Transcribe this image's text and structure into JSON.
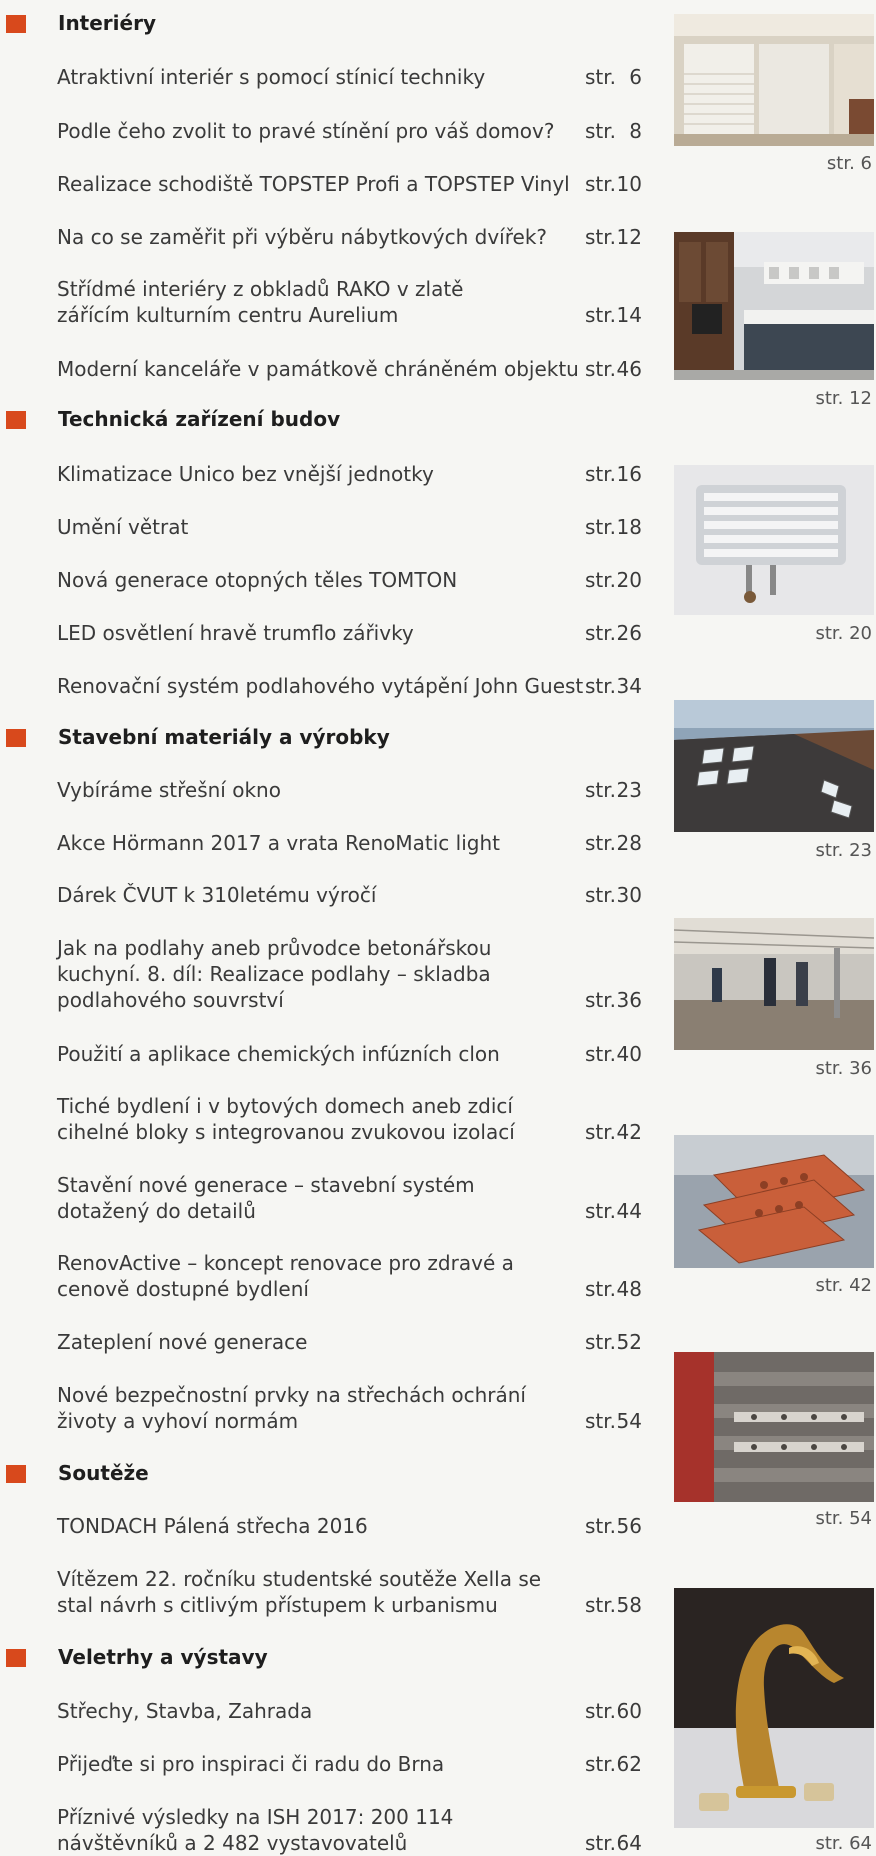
{
  "str_label": "str.",
  "sections": [
    {
      "title": "Interiéry",
      "items": [
        {
          "title": "Atraktivní interiér s pomocí stínicí techniky",
          "page": "6"
        },
        {
          "title": "Podle čeho zvolit to pravé stínění pro váš domov?",
          "page": "8"
        },
        {
          "title": "Realizace schodiště TOPSTEP Profi a TOPSTEP Vinyl",
          "page": "10"
        },
        {
          "title": "Na co se zaměřit při výběru nábytkových dvířek?",
          "page": "12"
        },
        {
          "title": "Střídmé interiéry z obkladů RAKO v zlatě zářícím kulturním centru Aurelium",
          "page": "14"
        },
        {
          "title": "Moderní kanceláře v památkově chráněném objektu",
          "page": "46"
        }
      ]
    },
    {
      "title": "Technická zařízení budov",
      "items": [
        {
          "title": "Klimatizace Unico bez vnější jednotky",
          "page": "16"
        },
        {
          "title": "Umění větrat",
          "page": "18"
        },
        {
          "title": "Nová generace otopných těles TOMTON",
          "page": "20"
        },
        {
          "title": "LED osvětlení hravě trumflo zářivky",
          "page": "26"
        },
        {
          "title": "Renovační systém podlahového vytápění John Guest",
          "page": "34"
        }
      ]
    },
    {
      "title": "Stavební materiály a výrobky",
      "items": [
        {
          "title": "Vybíráme střešní okno",
          "page": "23"
        },
        {
          "title": "Akce Hörmann 2017 a vrata RenoMatic light",
          "page": "28"
        },
        {
          "title": "Dárek ČVUT k 310letému výročí",
          "page": "30"
        },
        {
          "title": "Jak na podlahy aneb průvodce betonářskou kuchyní. 8. díl: Realizace podlahy – skladba podlahového souvrství",
          "page": "36"
        },
        {
          "title": "Použití a aplikace chemických infúzních clon",
          "page": "40"
        },
        {
          "title": "Tiché bydlení i v bytových domech aneb zdicí cihelné bloky s integrovanou zvukovou izolací",
          "page": "42"
        },
        {
          "title": "Stavění nové generace – stavební systém dotažený do detailů",
          "page": "44"
        },
        {
          "title": "RenovActive – koncept renovace pro zdravé a cenově dostupné bydlení",
          "page": "48"
        },
        {
          "title": "Zateplení nové generace",
          "page": "52"
        },
        {
          "title": "Nové bezpečnostní prvky na střechách ochrání životy a vyhoví normám",
          "page": "54"
        }
      ]
    },
    {
      "title": "Soutěže",
      "items": [
        {
          "title": "TONDACH Pálená střecha 2016",
          "page": "56"
        },
        {
          "title": "Vítězem 22. ročníku studentské soutěže Xella se stal návrh s citlivým přístupem k urbanismu",
          "page": "58"
        }
      ]
    },
    {
      "title": "Veletrhy a výstavy",
      "items": [
        {
          "title": "Střechy, Stavba, Zahrada",
          "page": "60"
        },
        {
          "title": "Přijeďte si pro inspiraci či radu do Brna",
          "page": "62"
        },
        {
          "title": "Příznivé výsledky na ISH 2017: 200 114 návštěvníků a 2 482 vystavovatelů",
          "page": "64"
        }
      ]
    }
  ],
  "thumbnails": [
    {
      "caption": "str. 6",
      "image": "interior-shading-photo"
    },
    {
      "caption": "str. 12",
      "image": "kitchen-cabinet-photo"
    },
    {
      "caption": "str. 20",
      "image": "radiator-photo"
    },
    {
      "caption": "str. 23",
      "image": "roof-windows-photo"
    },
    {
      "caption": "str. 36",
      "image": "concrete-floor-photo"
    },
    {
      "caption": "str. 42",
      "image": "clay-bricks-photo"
    },
    {
      "caption": "str. 54",
      "image": "roof-safety-photo"
    },
    {
      "caption": "str. 64",
      "image": "golden-swan-faucet-photo"
    }
  ]
}
